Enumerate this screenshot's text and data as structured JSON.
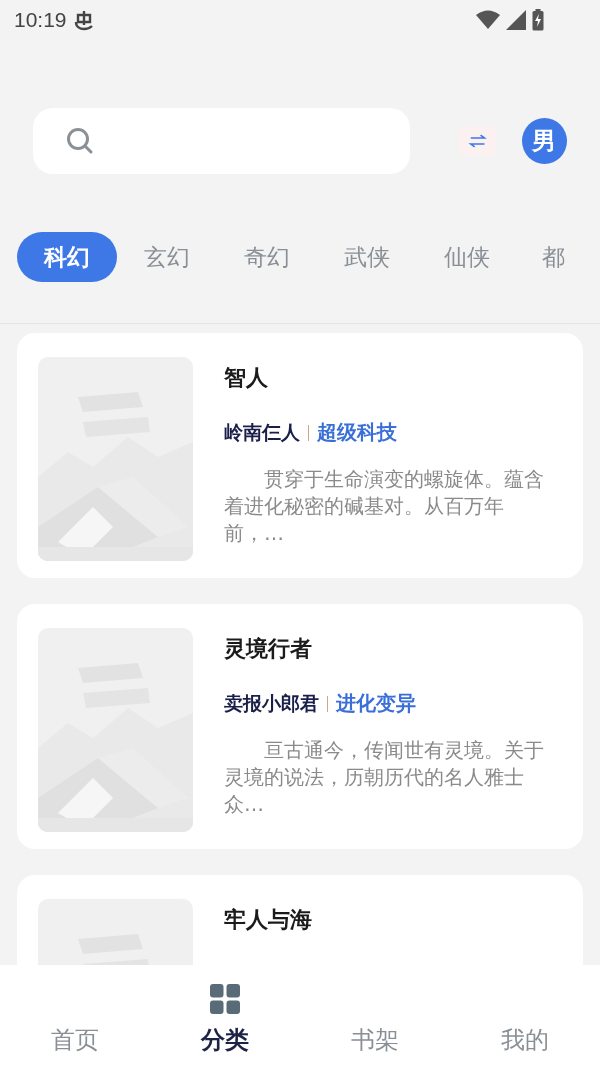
{
  "status_bar": {
    "time": "10:19"
  },
  "gender_switch": {
    "label": "男",
    "on": true
  },
  "tabs": [
    {
      "label": "科幻",
      "selected": true
    },
    {
      "label": "玄幻",
      "selected": false
    },
    {
      "label": "奇幻",
      "selected": false
    },
    {
      "label": "武侠",
      "selected": false
    },
    {
      "label": "仙侠",
      "selected": false
    },
    {
      "label": "都",
      "selected": false
    }
  ],
  "books": [
    {
      "title": "智人",
      "author": "岭南仨人",
      "genre": "超级科技",
      "description": "贯穿于生命演变的螺旋体。蕴含着进化秘密的碱基对。从百万年前，…"
    },
    {
      "title": "灵境行者",
      "author": "卖报小郎君",
      "genre": "进化变异",
      "description": "亘古通今，传闻世有灵境。关于灵境的说法，历朝历代的名人雅士众…"
    },
    {
      "title": "牢人与海"
    }
  ],
  "bottom_nav": [
    {
      "label": "首页",
      "selected": false
    },
    {
      "label": "分类",
      "selected": true
    },
    {
      "label": "书架",
      "selected": false
    },
    {
      "label": "我的",
      "selected": false
    }
  ]
}
